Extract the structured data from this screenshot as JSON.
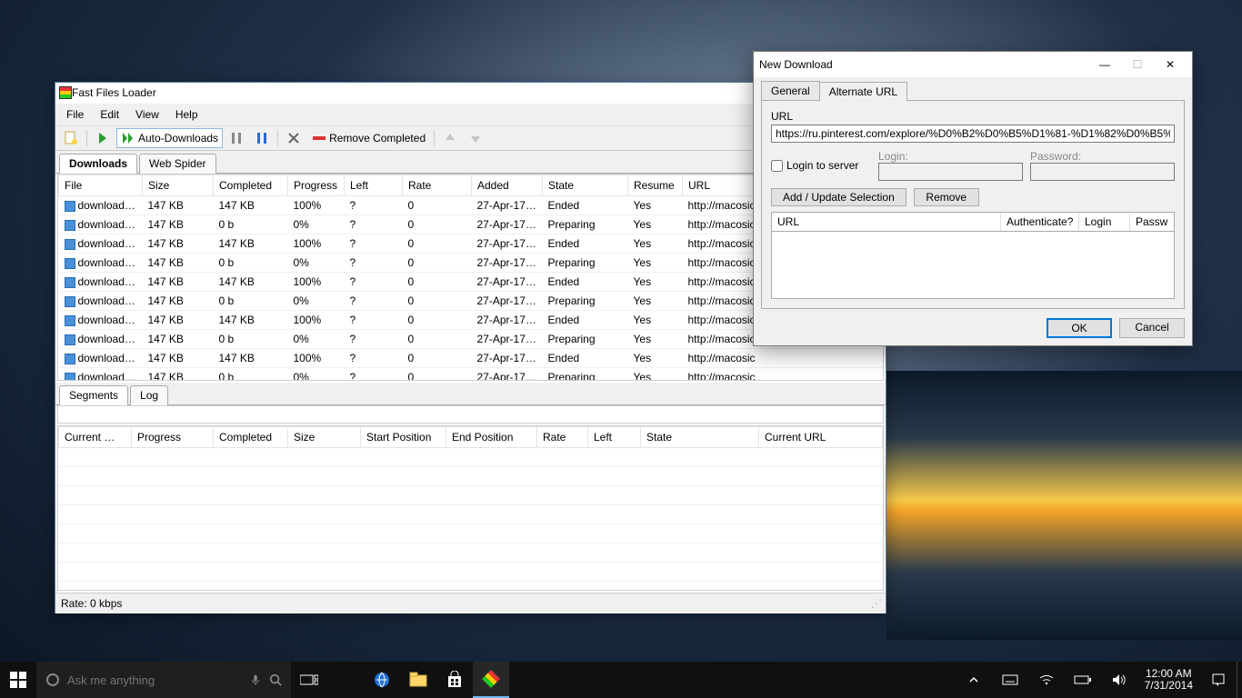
{
  "main": {
    "title": "Fast Files Loader",
    "menu": [
      "File",
      "Edit",
      "View",
      "Help"
    ],
    "toolbar": {
      "auto_downloads": "Auto-Downloads",
      "remove_completed": "Remove Completed"
    },
    "tabs": {
      "downloads": "Downloads",
      "webspider": "Web Spider"
    },
    "columns": [
      "File",
      "Size",
      "Completed",
      "Progress",
      "Left",
      "Rate",
      "Added",
      "State",
      "Resume",
      "URL"
    ],
    "rows": [
      {
        "file": "download-sh…",
        "size": "147 KB",
        "completed": "147 KB",
        "progress": "100%",
        "left": "?",
        "rate": "0",
        "added": "27-Apr-17 …",
        "state": "Ended",
        "resume": "Yes",
        "url": "http://macosic"
      },
      {
        "file": "download-sh…",
        "size": "147 KB",
        "completed": "0 b",
        "progress": "0%",
        "left": "?",
        "rate": "0",
        "added": "27-Apr-17 …",
        "state": "Preparing",
        "resume": "Yes",
        "url": "http://macosic"
      },
      {
        "file": "download-sh…",
        "size": "147 KB",
        "completed": "147 KB",
        "progress": "100%",
        "left": "?",
        "rate": "0",
        "added": "27-Apr-17 …",
        "state": "Ended",
        "resume": "Yes",
        "url": "http://macosic"
      },
      {
        "file": "download-sh…",
        "size": "147 KB",
        "completed": "0 b",
        "progress": "0%",
        "left": "?",
        "rate": "0",
        "added": "27-Apr-17 …",
        "state": "Preparing",
        "resume": "Yes",
        "url": "http://macosic"
      },
      {
        "file": "download-sh…",
        "size": "147 KB",
        "completed": "147 KB",
        "progress": "100%",
        "left": "?",
        "rate": "0",
        "added": "27-Apr-17 …",
        "state": "Ended",
        "resume": "Yes",
        "url": "http://macosic"
      },
      {
        "file": "download-sh…",
        "size": "147 KB",
        "completed": "0 b",
        "progress": "0%",
        "left": "?",
        "rate": "0",
        "added": "27-Apr-17 …",
        "state": "Preparing",
        "resume": "Yes",
        "url": "http://macosic"
      },
      {
        "file": "download-sh…",
        "size": "147 KB",
        "completed": "147 KB",
        "progress": "100%",
        "left": "?",
        "rate": "0",
        "added": "27-Apr-17 …",
        "state": "Ended",
        "resume": "Yes",
        "url": "http://macosic"
      },
      {
        "file": "download-sh…",
        "size": "147 KB",
        "completed": "0 b",
        "progress": "0%",
        "left": "?",
        "rate": "0",
        "added": "27-Apr-17 …",
        "state": "Preparing",
        "resume": "Yes",
        "url": "http://macosic"
      },
      {
        "file": "download-sh…",
        "size": "147 KB",
        "completed": "147 KB",
        "progress": "100%",
        "left": "?",
        "rate": "0",
        "added": "27-Apr-17 …",
        "state": "Ended",
        "resume": "Yes",
        "url": "http://macosic"
      },
      {
        "file": "download-sh…",
        "size": "147 KB",
        "completed": "0 b",
        "progress": "0%",
        "left": "?",
        "rate": "0",
        "added": "27-Apr-17 …",
        "state": "Preparing",
        "resume": "Yes",
        "url": "http://macosic"
      }
    ],
    "lower_tabs": {
      "segments": "Segments",
      "log": "Log"
    },
    "seg_columns": [
      "Current …",
      "Progress",
      "Completed",
      "Size",
      "Start Position",
      "End Position",
      "Rate",
      "Left",
      "State",
      "Current URL"
    ],
    "status": "Rate:  0 kbps"
  },
  "dialog": {
    "title": "New Download",
    "tabs": {
      "general": "General",
      "alt": "Alternate URL"
    },
    "url_label": "URL",
    "url_value": "https://ru.pinterest.com/explore/%D0%B2%D0%B5%D1%81-%D1%82%D0%B5%D0%BB%D0%",
    "login_to_server": "Login to server",
    "login_label": "Login:",
    "password_label": "Password:",
    "add_update": "Add / Update Selection",
    "remove": "Remove",
    "list_cols": [
      "URL",
      "Authenticate?",
      "Login",
      "Passw"
    ],
    "ok": "OK",
    "cancel": "Cancel"
  },
  "taskbar": {
    "search_placeholder": "Ask me anything",
    "time": "12:00 AM",
    "date": "7/31/2014"
  }
}
